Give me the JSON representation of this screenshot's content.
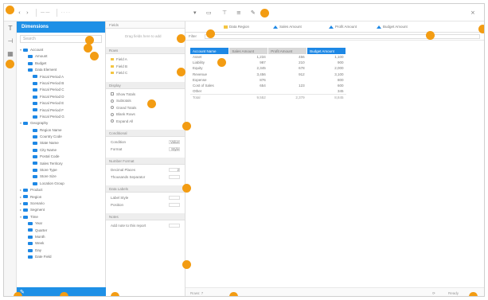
{
  "topbar": {
    "title_text": "· · · ·",
    "tool_icons": [
      "new-sheet-icon",
      "filter-icon",
      "sort-icon",
      "settings-icon"
    ]
  },
  "left_panel": {
    "header": "Dimensions",
    "search_placeholder": "Search",
    "tree": [
      {
        "label": "Account",
        "indent": 0,
        "expanded": true
      },
      {
        "label": "Amount",
        "indent": 1
      },
      {
        "label": "Budget",
        "indent": 1
      },
      {
        "label": "Data Element",
        "indent": 1
      },
      {
        "label": "Fiscal Period A",
        "indent": 2
      },
      {
        "label": "Fiscal Period B",
        "indent": 2
      },
      {
        "label": "Fiscal Period C",
        "indent": 2
      },
      {
        "label": "Fiscal Period D",
        "indent": 2
      },
      {
        "label": "Fiscal Period E",
        "indent": 2
      },
      {
        "label": "Fiscal Period F",
        "indent": 2
      },
      {
        "label": "Fiscal Period G",
        "indent": 2
      },
      {
        "label": "Geography",
        "indent": 0,
        "expanded": true
      },
      {
        "label": "Region Name",
        "indent": 2
      },
      {
        "label": "Country Code",
        "indent": 2
      },
      {
        "label": "State Name",
        "indent": 2
      },
      {
        "label": "City Name",
        "indent": 2
      },
      {
        "label": "Postal Code",
        "indent": 2
      },
      {
        "label": "Sales Territory",
        "indent": 2
      },
      {
        "label": "Store Type",
        "indent": 2
      },
      {
        "label": "Store Size",
        "indent": 2
      },
      {
        "label": "Location Group",
        "indent": 2
      },
      {
        "label": "Product",
        "indent": 0
      },
      {
        "label": "Region",
        "indent": 0
      },
      {
        "label": "Scenario",
        "indent": 0
      },
      {
        "label": "Segment",
        "indent": 0
      },
      {
        "label": "Time",
        "indent": 0,
        "expanded": true
      },
      {
        "label": "Year",
        "indent": 1
      },
      {
        "label": "Quarter",
        "indent": 1
      },
      {
        "label": "Month",
        "indent": 1
      },
      {
        "label": "Week",
        "indent": 1
      },
      {
        "label": "Day",
        "indent": 1
      },
      {
        "label": "Date Field",
        "indent": 1
      }
    ]
  },
  "mid_panel": {
    "tab_label": "Fields",
    "drag_hint": "Drag fields here to add",
    "sections": [
      {
        "title": "Rows",
        "items": [
          "Field A",
          "Field B",
          "Field C"
        ]
      },
      {
        "title": "Display",
        "options": [
          "Show Totals",
          "Subtotals",
          "Grand Totals",
          "Blank Rows",
          "Expand All"
        ]
      },
      {
        "title": "Conditional",
        "rows": [
          [
            "Condition",
            "Value"
          ],
          [
            "Format",
            "Style"
          ]
        ]
      },
      {
        "title": "Number Format",
        "rows": [
          [
            "Decimal Places",
            "2"
          ],
          [
            "Thousands Separator",
            ""
          ]
        ]
      },
      {
        "title": "Data Labels",
        "rows": [
          [
            "Label Style",
            ""
          ],
          [
            "Position",
            ""
          ]
        ]
      },
      {
        "title": "Notes",
        "rows": [
          [
            "Add note to this report",
            ""
          ]
        ]
      }
    ]
  },
  "main": {
    "filter_label": "Filter",
    "chips": [
      {
        "label": "Data Region",
        "kind": "yellow"
      },
      {
        "label": "Sales Amount",
        "kind": "tri"
      },
      {
        "label": "Profit Amount",
        "kind": "tri"
      },
      {
        "label": "Budget Amount",
        "kind": "tri"
      }
    ],
    "table": {
      "columns": [
        "Account Name",
        "Sales Amount",
        "Profit Amount",
        "Budget Amount"
      ],
      "rows": [
        [
          "Asset",
          "1,234",
          "456",
          "1,100"
        ],
        [
          "Liability",
          "987",
          "210",
          "900"
        ],
        [
          "Equity",
          "2,345",
          "678",
          "2,000"
        ],
        [
          "Revenue",
          "3,456",
          "912",
          "3,100"
        ],
        [
          "Expense",
          "876",
          "",
          "800"
        ],
        [
          "Cost of Sales",
          "654",
          "123",
          "600"
        ],
        [
          "Other",
          "",
          "",
          "345"
        ]
      ],
      "total": [
        "Total",
        "9,552",
        "2,379",
        "8,845"
      ]
    },
    "status_left": "Rows: 7",
    "status_right": "Ready"
  },
  "markers": [
    "1",
    "2",
    "3",
    "4",
    "5",
    "6",
    "7",
    "8",
    "9",
    "10",
    "11",
    "12",
    "13",
    "14",
    "15",
    "16",
    "17",
    "18",
    "19",
    "20",
    "21"
  ]
}
